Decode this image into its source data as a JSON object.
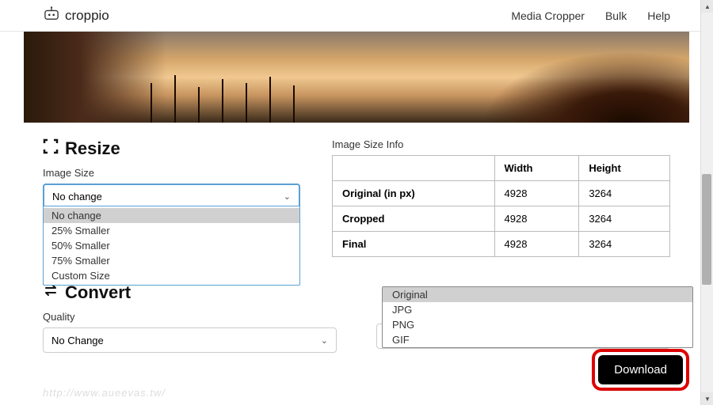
{
  "header": {
    "brand": "croppio",
    "nav": [
      "Media Cropper",
      "Bulk",
      "Help"
    ]
  },
  "resize": {
    "title": "Resize",
    "label": "Image Size",
    "selected": "No change",
    "options": [
      "No change",
      "25% Smaller",
      "50% Smaller",
      "75% Smaller",
      "Custom Size"
    ]
  },
  "sizeinfo": {
    "label": "Image Size Info",
    "cols": [
      "",
      "Width",
      "Height"
    ],
    "rows": [
      {
        "label": "Original (in px)",
        "w": "4928",
        "h": "3264"
      },
      {
        "label": "Cropped",
        "w": "4928",
        "h": "3264"
      },
      {
        "label": "Final",
        "w": "4928",
        "h": "3264"
      }
    ]
  },
  "convert": {
    "title": "Convert",
    "quality_label": "Quality",
    "quality_selected": "No Change",
    "format_selected": "Original",
    "format_options": [
      "Original",
      "JPG",
      "PNG",
      "GIF"
    ]
  },
  "download": "Download",
  "watermark": "http://www.aueevas.tw/"
}
